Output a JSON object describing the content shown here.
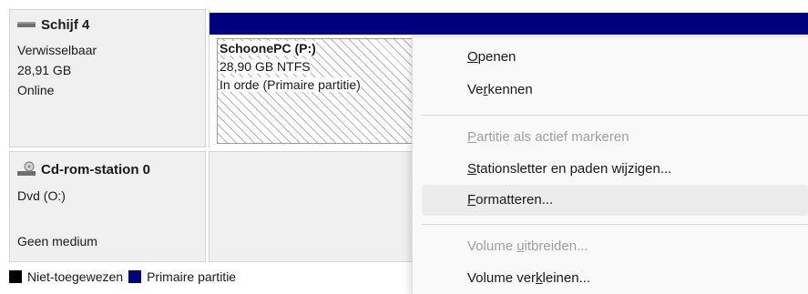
{
  "disks": [
    {
      "title": "Schijf 4",
      "icon": "removable-disk-icon",
      "type": "Verwisselbaar",
      "size": "28,91 GB",
      "status": "Online",
      "bar_color": "#00007f",
      "partition": {
        "name": "SchoonePC  (P:)",
        "size_fs": "28,90 GB NTFS",
        "status": "In orde (Primaire partitie)"
      }
    },
    {
      "title": "Cd-rom-station 0",
      "icon": "cd-rom-drive-icon",
      "type": "Dvd (O:)",
      "status": "Geen medium"
    }
  ],
  "legend": [
    {
      "label": "Niet-toegewezen",
      "color": "#000000"
    },
    {
      "label": "Primaire partitie",
      "color": "#00007f"
    }
  ],
  "context_menu": {
    "items": [
      {
        "label_pre": "",
        "accel": "O",
        "label_post": "penen",
        "enabled": true
      },
      {
        "label_pre": "Ve",
        "accel": "r",
        "label_post": "kennen",
        "enabled": true
      },
      {
        "label_pre": "",
        "accel": "P",
        "label_post": "artitie als actief markeren",
        "enabled": false
      },
      {
        "label_pre": "",
        "accel": "S",
        "label_post": "tationsletter en paden wijzigen...",
        "enabled": true
      },
      {
        "label_pre": "",
        "accel": "F",
        "label_post": "ormatteren...",
        "enabled": true,
        "highlighted": true
      },
      {
        "label_pre": "Volume ",
        "accel": "u",
        "label_post": "itbreiden...",
        "enabled": false
      },
      {
        "label_pre": "Volume ver",
        "accel": "k",
        "label_post": "leinen...",
        "enabled": true
      }
    ]
  }
}
